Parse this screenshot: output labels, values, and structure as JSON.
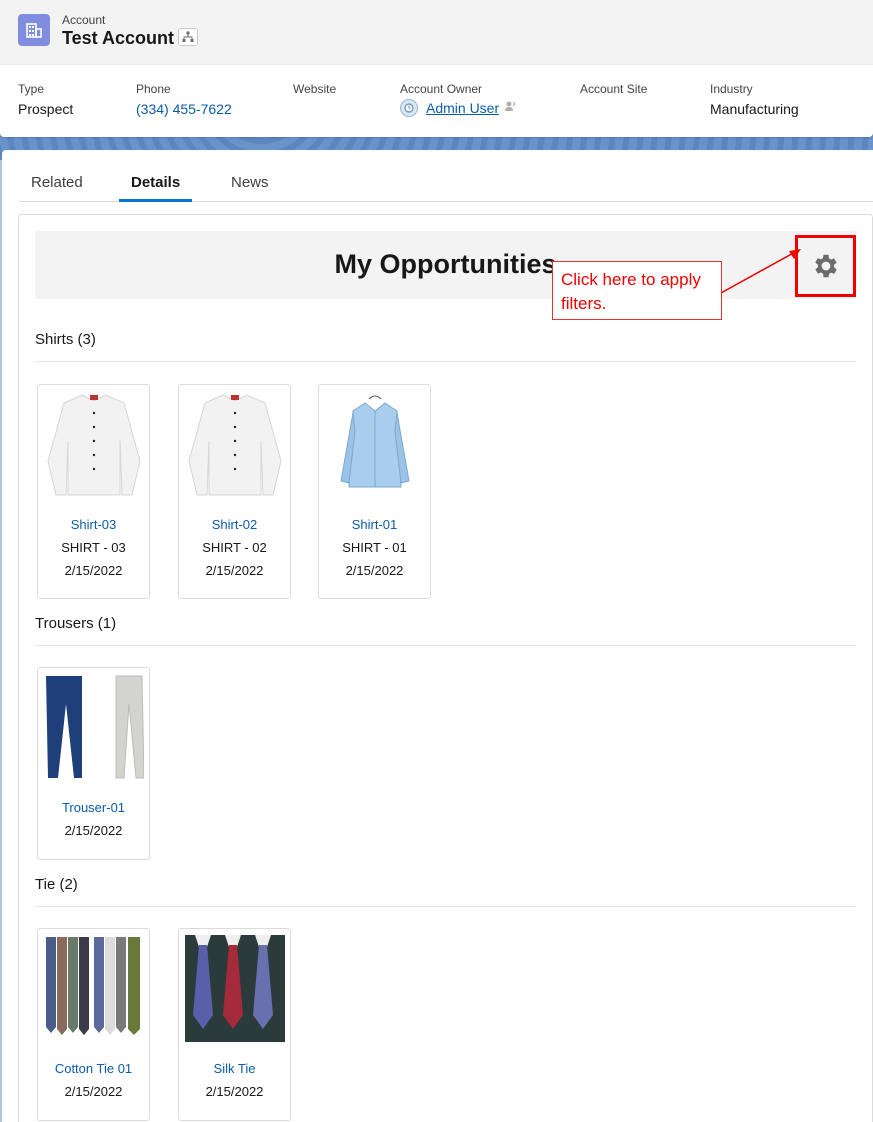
{
  "header": {
    "object_label": "Account",
    "account_name": "Test Account",
    "fields": [
      {
        "label": "Type",
        "value": "Prospect"
      },
      {
        "label": "Phone",
        "value": "(334) 455-7622"
      },
      {
        "label": "Website",
        "value": ""
      },
      {
        "label": "Account Owner",
        "value": "Admin User"
      },
      {
        "label": "Account Site",
        "value": ""
      },
      {
        "label": "Industry",
        "value": "Manufacturing"
      }
    ]
  },
  "tabs": [
    "Related",
    "Details",
    "News"
  ],
  "active_tab": "Details",
  "opportunities": {
    "title": "My Opportunities",
    "callout": "Click here to apply filters.",
    "groups": [
      {
        "title": "Shirts (3)",
        "items": [
          {
            "name": "Shirt-03",
            "code": "SHIRT - 03",
            "date": "2/15/2022"
          },
          {
            "name": "Shirt-02",
            "code": "SHIRT - 02",
            "date": "2/15/2022"
          },
          {
            "name": "Shirt-01",
            "code": "SHIRT - 01",
            "date": "2/15/2022"
          }
        ]
      },
      {
        "title": "Trousers (1)",
        "items": [
          {
            "name": "Trouser-01",
            "date": "2/15/2022"
          }
        ]
      },
      {
        "title": "Tie (2)",
        "items": [
          {
            "name": "Cotton Tie 01",
            "date": "2/15/2022"
          },
          {
            "name": "Silk Tie",
            "date": "2/15/2022"
          }
        ]
      }
    ]
  },
  "colors": {
    "accent": "#0176d3",
    "link": "#0b5cab",
    "annotation": "#e00000",
    "account_icon": "#7f8de1"
  }
}
